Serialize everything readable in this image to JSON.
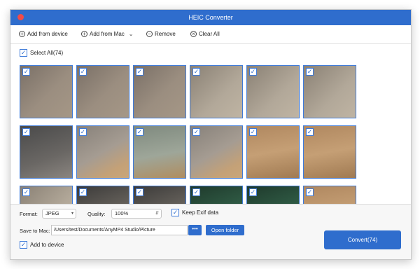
{
  "window": {
    "title": "HEIC Converter"
  },
  "toolbar": {
    "add_device": "Add from device",
    "add_mac": "Add from Mac",
    "remove": "Remove",
    "clear_all": "Clear All"
  },
  "selection": {
    "select_all_label": "Select All(74)",
    "checked": true
  },
  "thumbnails": [
    {
      "row": 0,
      "col": 0,
      "style": "tc0",
      "checked": true
    },
    {
      "row": 0,
      "col": 1,
      "style": "tc0",
      "checked": true
    },
    {
      "row": 0,
      "col": 2,
      "style": "tc0",
      "checked": true
    },
    {
      "row": 0,
      "col": 3,
      "style": "tc1",
      "checked": true
    },
    {
      "row": 0,
      "col": 4,
      "style": "tc1",
      "checked": true
    },
    {
      "row": 0,
      "col": 5,
      "style": "tc1",
      "checked": true
    },
    {
      "row": 1,
      "col": 0,
      "style": "tc2",
      "checked": true
    },
    {
      "row": 1,
      "col": 1,
      "style": "tc3",
      "checked": true
    },
    {
      "row": 1,
      "col": 2,
      "style": "tc4",
      "checked": true
    },
    {
      "row": 1,
      "col": 3,
      "style": "tc3",
      "checked": true
    },
    {
      "row": 1,
      "col": 4,
      "style": "tc6",
      "checked": true
    },
    {
      "row": 1,
      "col": 5,
      "style": "tc6",
      "checked": true
    },
    {
      "row": 2,
      "col": 0,
      "style": "tc1",
      "checked": true
    },
    {
      "row": 2,
      "col": 1,
      "style": "tc5",
      "checked": true
    },
    {
      "row": 2,
      "col": 2,
      "style": "tc5",
      "checked": true
    },
    {
      "row": 2,
      "col": 3,
      "style": "tc7",
      "checked": true
    },
    {
      "row": 2,
      "col": 4,
      "style": "tc7",
      "checked": true
    },
    {
      "row": 2,
      "col": 5,
      "style": "tc6",
      "checked": true
    }
  ],
  "settings": {
    "format_label": "Format:",
    "format_value": "JPEG",
    "quality_label": "Quality:",
    "quality_value": "100%",
    "keep_exif_label": "Keep Exif data",
    "keep_exif_checked": true,
    "save_label": "Save to Mac:",
    "save_path": "/Users/test/Documents/AnyMP4 Studio/Picture",
    "browse_label": "•••",
    "open_folder": "Open folder",
    "add_to_device_label": "Add to device",
    "add_to_device_checked": true,
    "convert_label": "Convert(74)"
  },
  "colors": {
    "accent": "#2f6dcd",
    "close": "#f04b49"
  },
  "icons": {
    "add_device": "plus-circle-icon",
    "add_mac": "plus-circle-icon",
    "remove": "minus-circle-icon",
    "clear_all": "x-circle-icon",
    "add_mac_menu": "chevron-down-icon",
    "checkbox": "checkmark-icon"
  }
}
